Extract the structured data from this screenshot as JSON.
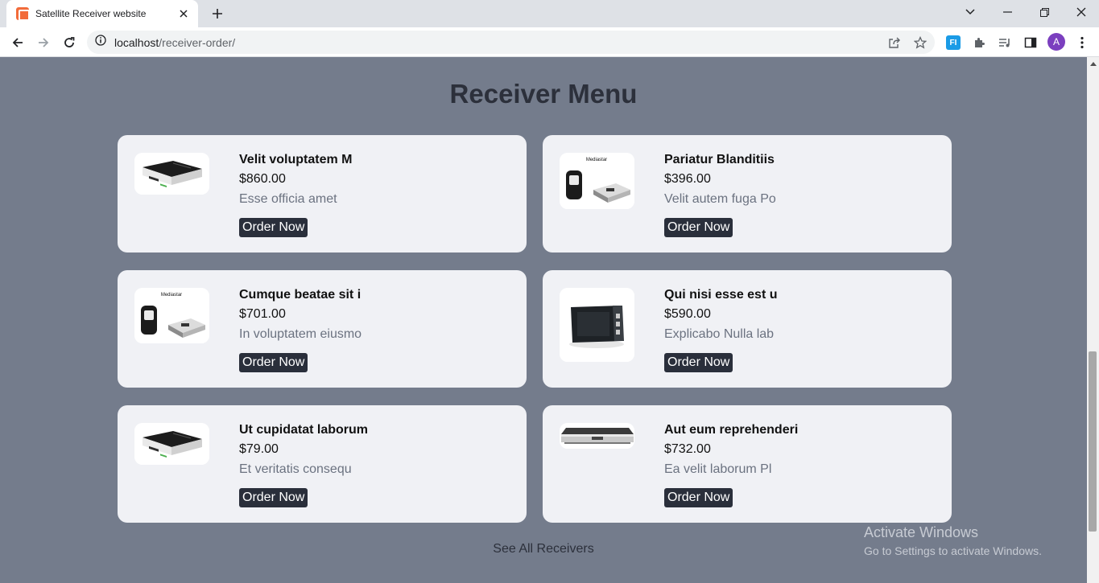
{
  "browser": {
    "tab_title": "Satellite Receiver website",
    "url_host": "localhost",
    "url_path": "/receiver-order/",
    "profile_initial": "A",
    "ext_label": "FI"
  },
  "page": {
    "title": "Receiver Menu",
    "see_all": "See All Receivers"
  },
  "products": [
    {
      "name": "Velit voluptatem M",
      "price": "$860.00",
      "desc": "Esse officia amet",
      "button": "Order Now",
      "image": "receiver-box-white"
    },
    {
      "name": "Pariatur Blanditiis",
      "price": "$396.00",
      "desc": "Velit autem fuga Po",
      "button": "Order Now",
      "image": "receiver-with-remote"
    },
    {
      "name": "Cumque beatae sit i",
      "price": "$701.00",
      "desc": "In voluptatem eiusmo",
      "button": "Order Now",
      "image": "receiver-with-remote"
    },
    {
      "name": "Qui nisi esse est u",
      "price": "$590.00",
      "desc": "Explicabo Nulla lab",
      "button": "Order Now",
      "image": "receiver-box-black"
    },
    {
      "name": "Ut cupidatat laborum",
      "price": "$79.00",
      "desc": "Et veritatis consequ",
      "button": "Order Now",
      "image": "receiver-box-white"
    },
    {
      "name": "Aut eum reprehenderi",
      "price": "$732.00",
      "desc": "Ea velit laborum Pl",
      "button": "Order Now",
      "image": "receiver-slim-silver"
    }
  ],
  "watermark": {
    "line1": "Activate Windows",
    "line2": "Go to Settings to activate Windows."
  }
}
